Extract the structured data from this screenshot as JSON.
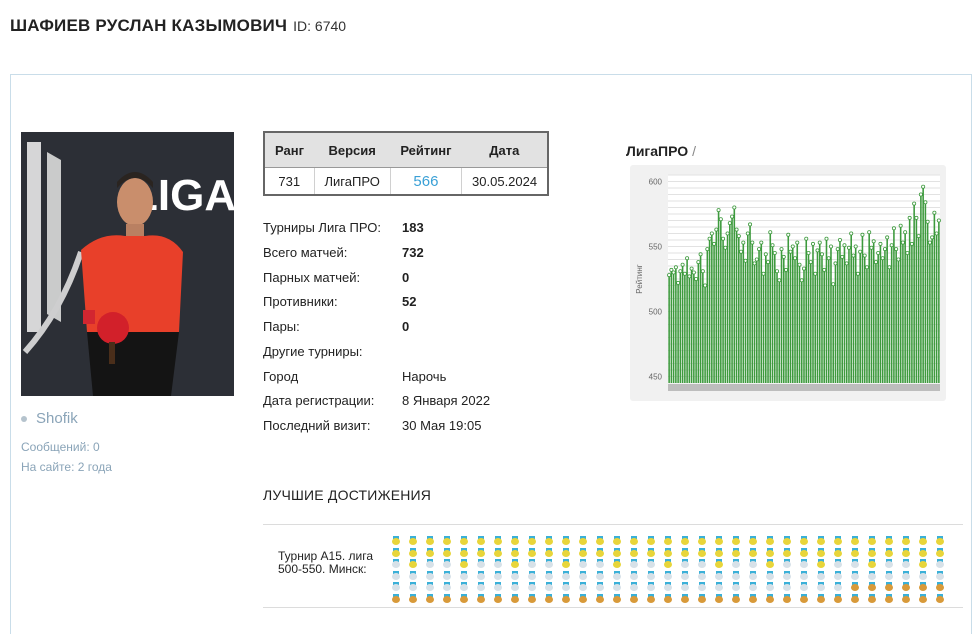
{
  "profile": {
    "name": "ШАФИЕВ РУСЛАН КАЗЫМОВИЧ",
    "id_label": "ID: 6740",
    "username": "Shofik",
    "messages": "Сообщений: 0",
    "on_site": "На сайте: 2 года",
    "photo_text": "LIGA PRO"
  },
  "rank_table": {
    "headers": [
      "Ранг",
      "Версия",
      "Рейтинг",
      "Дата"
    ],
    "row": [
      "731",
      "ЛигаПРО",
      "566",
      "30.05.2024"
    ]
  },
  "stats": [
    {
      "label": "Турниры Лига ПРО:",
      "value": "183",
      "bold": true
    },
    {
      "label": "Всего матчей:",
      "value": "732",
      "bold": true
    },
    {
      "label": "Парных матчей:",
      "value": "0",
      "bold": true
    },
    {
      "label": "Противники:",
      "value": "52",
      "bold": true
    },
    {
      "label": "Пары:",
      "value": "0",
      "bold": true
    },
    {
      "label": "Другие турниры:",
      "value": "",
      "bold": false
    },
    {
      "label": "Город",
      "value": "Нарочь",
      "bold": false
    },
    {
      "label": "Дата регистрации:",
      "value": "8 Января 2022",
      "bold": false
    },
    {
      "label": "Последний визит:",
      "value": "30 Мая 19:05",
      "bold": false
    }
  ],
  "chart_title": "ЛигаПРО",
  "chart_title_sep": "/",
  "chart_data": {
    "type": "bar",
    "ylabel": "Рейтинг",
    "xlabel": "",
    "ylim": [
      445,
      605
    ],
    "yticks": [
      450,
      500,
      550,
      600
    ],
    "grid": true,
    "bar_color": "#3d9a3d",
    "values": [
      528,
      532,
      530,
      534,
      522,
      531,
      536,
      529,
      541,
      527,
      533,
      530,
      525,
      538,
      544,
      531,
      520,
      548,
      556,
      560,
      552,
      563,
      578,
      571,
      556,
      549,
      560,
      568,
      573,
      580,
      563,
      558,
      546,
      553,
      539,
      560,
      567,
      553,
      537,
      540,
      548,
      553,
      529,
      544,
      538,
      561,
      551,
      545,
      531,
      524,
      548,
      542,
      532,
      559,
      546,
      550,
      541,
      553,
      536,
      524,
      533,
      556,
      545,
      538,
      552,
      529,
      547,
      553,
      544,
      532,
      556,
      541,
      550,
      521,
      537,
      548,
      555,
      542,
      551,
      537,
      549,
      560,
      543,
      550,
      529,
      546,
      559,
      543,
      534,
      561,
      549,
      554,
      538,
      545,
      552,
      541,
      548,
      557,
      534,
      551,
      564,
      548,
      540,
      566,
      553,
      561,
      545,
      572,
      552,
      583,
      572,
      558,
      590,
      596,
      584,
      569,
      553,
      557,
      576,
      560,
      570
    ]
  },
  "achievements": {
    "title": "ЛУЧШИЕ ДОСТИЖЕНИЯ",
    "items": [
      {
        "name": "Турнир А15. лига 500-550. Минск:"
      }
    ],
    "colors": {
      "gold": "#e8d53a",
      "silver": "#d7e1e8",
      "bronze": "#d89a3a",
      "ribbon": "#3ab0d8"
    }
  }
}
